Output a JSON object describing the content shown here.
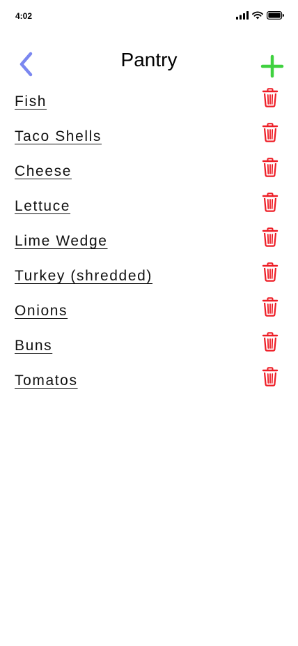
{
  "status_bar": {
    "time": "4:02",
    "icons": [
      "signal-icon",
      "wifi-icon",
      "battery-icon"
    ]
  },
  "header": {
    "title": "Pantry",
    "back_icon": "chevron-left-icon",
    "add_icon": "plus-icon"
  },
  "colors": {
    "back": "#7b87f0",
    "add": "#3fd13f",
    "delete": "#ee1c25"
  },
  "items": [
    {
      "label": "Fish"
    },
    {
      "label": "Taco Shells"
    },
    {
      "label": "Cheese"
    },
    {
      "label": "Lettuce"
    },
    {
      "label": "Lime Wedge"
    },
    {
      "label": "Turkey (shredded)"
    },
    {
      "label": "Onions"
    },
    {
      "label": "Buns"
    },
    {
      "label": "Tomatos"
    }
  ],
  "item_action_icon": "trash-icon"
}
